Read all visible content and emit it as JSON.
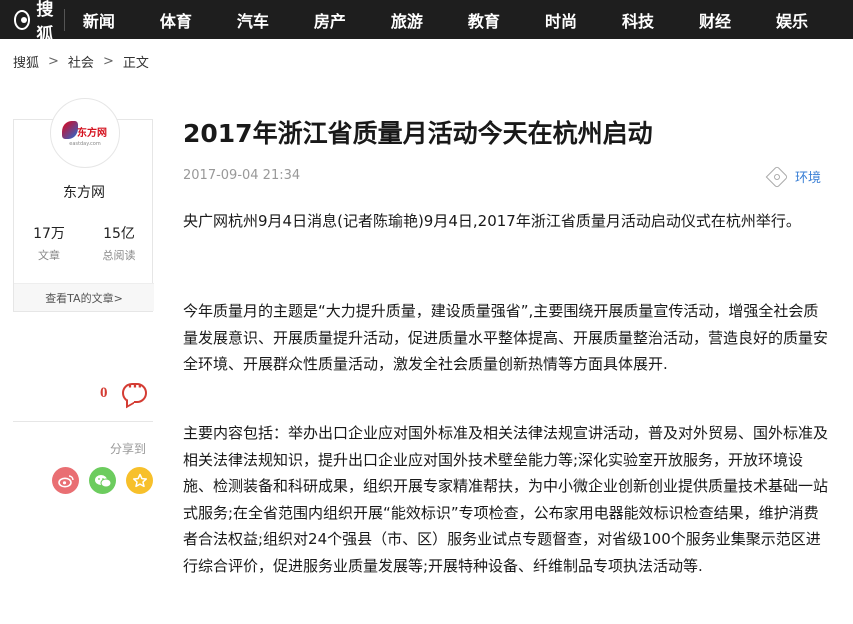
{
  "header": {
    "brand": "搜狐",
    "nav": [
      "新闻",
      "体育",
      "汽车",
      "房产",
      "旅游",
      "教育",
      "时尚",
      "科技",
      "财经",
      "娱乐"
    ]
  },
  "breadcrumb": {
    "home": "搜狐",
    "section": "社会",
    "current": "正文",
    "separator": ">"
  },
  "author": {
    "logo_text": "东方网",
    "logo_sub": "eastday.com",
    "name": "东方网",
    "articles_count": "17万",
    "articles_label": "文章",
    "reads_count": "15亿",
    "reads_label": "总阅读",
    "view_more": "查看TA的文章>"
  },
  "social": {
    "comment_count": "0",
    "share_label": "分享到",
    "share_icons": [
      "weibo-icon",
      "wechat-icon",
      "favorite-icon"
    ]
  },
  "article": {
    "title": "2017年浙江省质量月活动今天在杭州启动",
    "datetime": "2017-09-04 21:34",
    "tag": "环境",
    "paragraphs": [
      "央广网杭州9月4日消息(记者陈瑜艳)9月4日,2017年浙江省质量月活动启动仪式在杭州举行。",
      "今年质量月的主题是“大力提升质量，建设质量强省”,主要围绕开展质量宣传活动，增强全社会质量发展意识、开展质量提升活动，促进质量水平整体提高、开展质量整治活动，营造良好的质量安全环境、开展群众性质量活动，激发全社会质量创新热情等方面具体展开.",
      "主要内容包括：举办出口企业应对国外标准及相关法律法规宣讲活动，普及对外贸易、国外标准及相关法律法规知识，提升出口企业应对国外技术壁垒能力等;深化实验室开放服务，开放环境设施、检测装备和科研成果，组织开展专家精准帮扶，为中小微企业创新创业提供质量技术基础一站式服务;在全省范围内组织开展“能效标识”专项检查，公布家用电器能效标识检查结果，维护消费者合法权益;组织对24个强县（市、区）服务业试点专题督查，对省级100个服务业集聚示范区进行综合评价，促进服务业质量发展等;开展特种设备、纤维制品专项执法活动等."
    ]
  }
}
